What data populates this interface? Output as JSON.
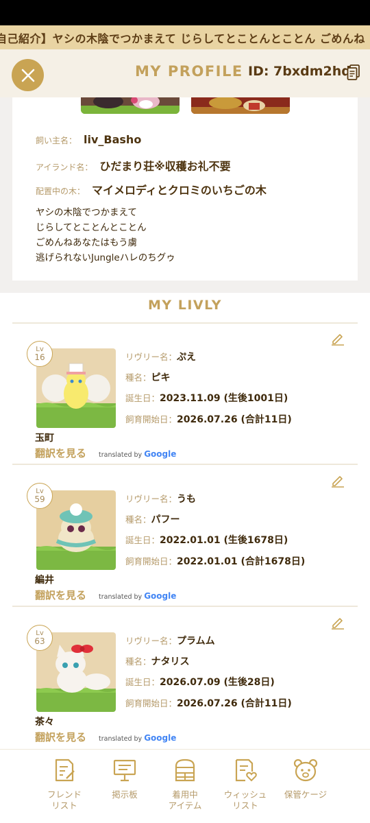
{
  "marquee": {
    "text": "自己紹介】ヤシの木陰でつかまえて じらしてとことんとことん ごめんね"
  },
  "header": {
    "title": "MY PROFILE",
    "id_text": "ID: 7bxdm2hd"
  },
  "profile": {
    "owner_label": "飼い主名：",
    "owner_value": "liv_Basho",
    "island_label": "アイランド名：",
    "island_value": "ひだまり荘※収穫お礼不要",
    "tree_label": "配置中の木：",
    "tree_value": "マイメロディとクロミのいちごの木",
    "bio": [
      "ヤシの木陰でつかまえて",
      "じらしてとことんとことん",
      "ごめんねあなたはもう虜",
      "逃げられないJungleハレのちグゥ"
    ]
  },
  "my_livly": {
    "title": "MY LIVLY",
    "name_key": "リヴリー名：",
    "species_key": "種名：",
    "birthday_key": "誕生日：",
    "start_key": "飼育開始日：",
    "translate_link": "翻訳を見る",
    "translated_by": "translated by",
    "google": "Google",
    "items": [
      {
        "lv_label": "Lv",
        "lv": "16",
        "name": "ぷえ",
        "species": "ピキ",
        "birthday": "2023.11.09 (生後1001日)",
        "start": "2026.07.26 (合計11日)",
        "nickname": "玉町"
      },
      {
        "lv_label": "Lv",
        "lv": "59",
        "name": "うも",
        "species": "パフー",
        "birthday": "2022.01.01 (生後1678日)",
        "start": "2022.01.01 (合計1678日)",
        "nickname": "編井"
      },
      {
        "lv_label": "Lv",
        "lv": "63",
        "name": "プラムム",
        "species": "ナタリス",
        "birthday": "2026.07.09 (生後28日)",
        "start": "2026.07.26 (合計11日)",
        "nickname": "茶々"
      }
    ]
  },
  "tabbar": {
    "items": [
      {
        "label": "フレンド\nリスト",
        "icon": "friend-list-icon"
      },
      {
        "label": "掲示板",
        "icon": "bulletin-board-icon"
      },
      {
        "label": "着用中\nアイテム",
        "icon": "wardrobe-icon"
      },
      {
        "label": "ウィッシュ\nリスト",
        "icon": "wishlist-icon"
      },
      {
        "label": "保管ケージ",
        "icon": "storage-cage-icon"
      }
    ]
  },
  "colors": {
    "accent": "#c9a453",
    "marquee_bg": "#e9d4a3",
    "header_bg": "#f5f0e6",
    "text_brown": "#5a3b14"
  }
}
